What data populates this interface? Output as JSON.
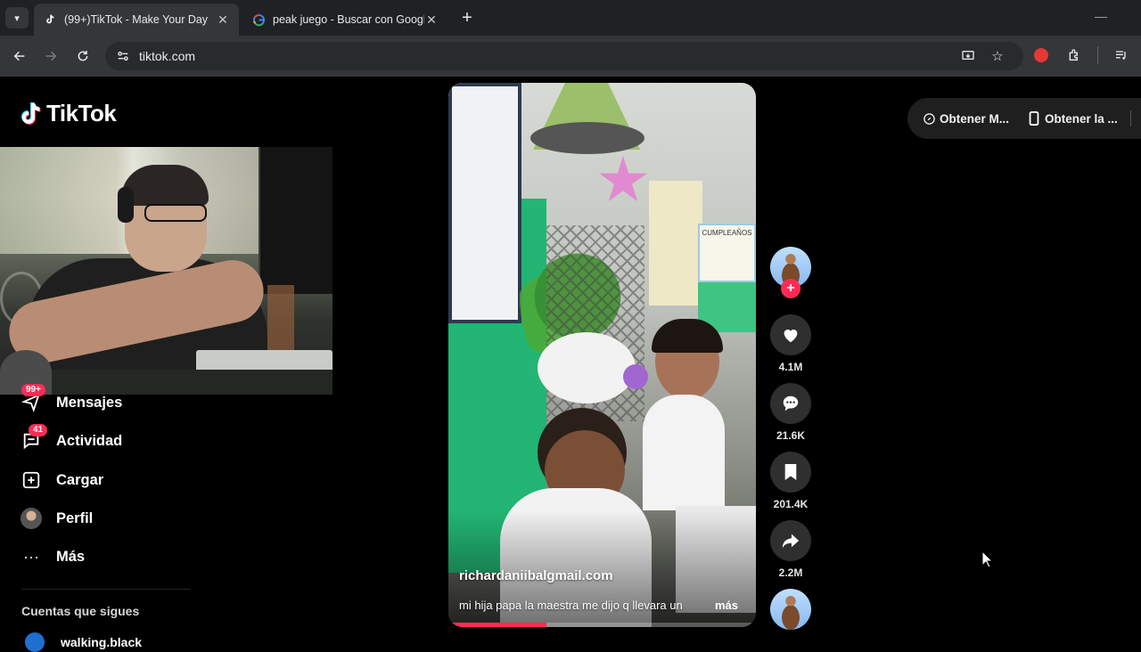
{
  "browser": {
    "tabs": [
      {
        "title": "(99+)TikTok - Make Your Day",
        "favicon": "tiktok-icon",
        "active": true
      },
      {
        "title": "peak juego - Buscar con Google",
        "favicon": "google-icon",
        "active": false
      }
    ],
    "url": "tiktok.com"
  },
  "sidebar": {
    "logo": "TikTok",
    "messages_badge": "99+",
    "items": [
      {
        "label": "Mensajes",
        "icon": "paper-plane-icon"
      },
      {
        "label": "Actividad",
        "icon": "inbox-icon",
        "badge": "41"
      },
      {
        "label": "Cargar",
        "icon": "plus-square-icon"
      },
      {
        "label": "Perfil",
        "icon": "avatar"
      },
      {
        "label": "Más",
        "icon": "more-icon"
      }
    ],
    "following_title": "Cuentas que sigues",
    "following": [
      {
        "name": "walking.black"
      }
    ]
  },
  "video": {
    "author": "richardaniibalgmail.com",
    "caption": "mi hija papa la maestra me dijo q llevara un",
    "more": "más",
    "wall_sign": "CUMPLEAÑOS",
    "progress": 0.32
  },
  "actions": {
    "likes": "4.1M",
    "comments": "21.6K",
    "saves": "201.4K",
    "shares": "2.2M"
  },
  "top_right": {
    "coins": "Obtener M...",
    "app": "Obtener la ..."
  },
  "colors": {
    "accent": "#fe2c55",
    "chrome_dark": "#202124",
    "chrome_toolbar": "#35363a"
  }
}
